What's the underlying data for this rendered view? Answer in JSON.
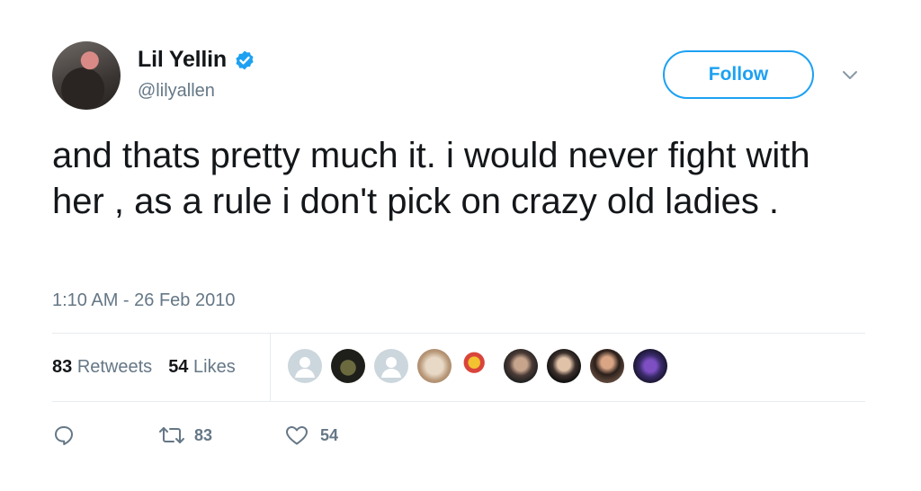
{
  "author": {
    "display_name": "Lil Yellin",
    "handle": "@lilyallen",
    "verified_icon": "verified-badge-icon"
  },
  "follow_label": "Follow",
  "tweet": {
    "text": "and thats pretty much it. i would never fight with her , as a rule i don't pick on crazy old ladies .",
    "timestamp": "1:10 AM - 26 Feb 2010"
  },
  "stats": {
    "retweets_count": "83",
    "retweets_label": "Retweets",
    "likes_count": "54",
    "likes_label": "Likes"
  },
  "actions": {
    "reply_icon": "reply-icon",
    "retweet_icon": "retweet-icon",
    "retweet_count": "83",
    "like_icon": "heart-icon",
    "like_count": "54"
  },
  "colors": {
    "accent": "#1da1f2",
    "secondary_text": "#657786",
    "primary_text": "#14171a",
    "divider": "#e6ecf0"
  }
}
